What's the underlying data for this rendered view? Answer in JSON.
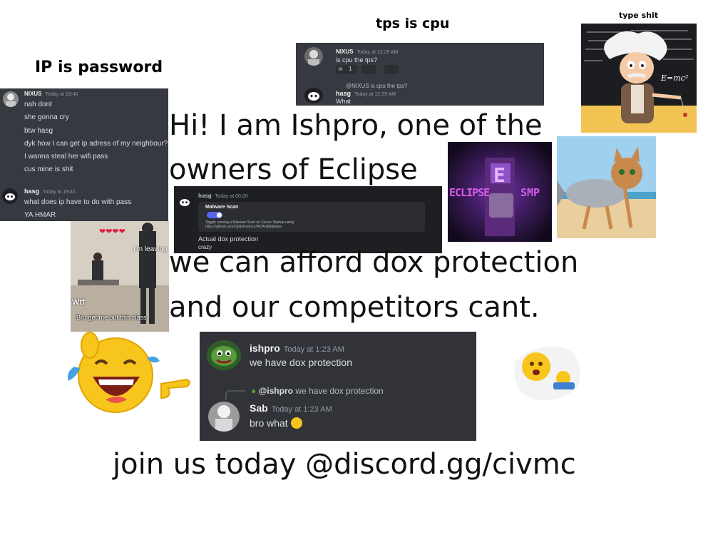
{
  "captions": {
    "ip_password": "IP is password",
    "tps_cpu": "tps is cpu",
    "type_shit": "type shit"
  },
  "headline": {
    "line1": "Hi! I am Ishpro, one of the",
    "line2": "owners of Eclipse",
    "line3": "we can afford dox protection",
    "line4": "and our competitors cant.",
    "cta": "join us today @discord.gg/civmc"
  },
  "chat_ip": {
    "user1": "NIXUS",
    "time1": "Today at 19:40",
    "msgs1": [
      "nah dont",
      "she gonna cry",
      "btw hasg",
      "dyk how I can get ip adress of my neighbour?",
      "I wanna steal her wifi pass",
      "cus mine is shit"
    ],
    "user2": "hasg",
    "time2": "Today at 19:41",
    "msgs2": [
      "what does ip have to do with pass",
      "YA HMAR"
    ]
  },
  "chat_tps": {
    "user1": "NIXUS",
    "time1": "Today at 12:29 AM",
    "msg1": "is cpu the tps?",
    "reaction_count": "1",
    "reply_preview": "@NIXUS is cpu the tps?",
    "user2": "hasg",
    "time2": "Today at 12:29 AM",
    "msg2": "What"
  },
  "chat_malware": {
    "user": "hasg",
    "time": "Today at 00:20",
    "card_title": "Malware Scan",
    "card_desc": "Toggle running a Malware Scan on Server Startup using https://github.com/OpticFusion1/MCAntiMalware.",
    "msg1": "Actual dox protection",
    "msg2": "crazy"
  },
  "chat_dox": {
    "user1": "ishpro",
    "time1": "Today at 1:23 AM",
    "msg1": "we have dox protection",
    "reply_user": "@ishpro",
    "reply_text": "we have dox protection",
    "user2": "Sab",
    "time2": "Today at 1:23 AM",
    "msg2": "bro what"
  },
  "meme_classroom": {
    "top": "❤❤❤❤",
    "side": "I'm leaving",
    "wtf": "Wtf",
    "bottom": "Bru get me out this class"
  },
  "eclipse_logo": {
    "left": "ECLIPSE",
    "center": "E",
    "right": "SMP"
  },
  "einstein": {
    "board": "E=mc²"
  },
  "colors": {
    "discord_bg": "#313338",
    "discord_dark": "#1e1f22",
    "toggle_blue": "#5865f2",
    "eclipse_purple": "#c24bd6"
  }
}
